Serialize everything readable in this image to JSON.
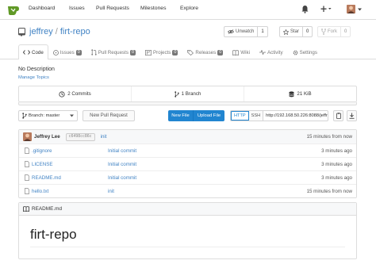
{
  "colors": {
    "brand": "#609926",
    "link": "#4183c4",
    "primary": "#2185d0"
  },
  "topnav": {
    "items": [
      "Dashboard",
      "Issues",
      "Pull Requests",
      "Milestones",
      "Explore"
    ],
    "icons": [
      "bell-icon",
      "plus-icon",
      "avatar"
    ]
  },
  "repo": {
    "owner": "jeffrey",
    "separator": "/",
    "name": "firt-repo",
    "watch": {
      "label": "Unwatch",
      "count": "1"
    },
    "star": {
      "label": "Star",
      "count": "0"
    },
    "fork": {
      "label": "Fork",
      "count": "0"
    }
  },
  "tabs": [
    {
      "label": "Code",
      "icon": "code-icon"
    },
    {
      "label": "Issues",
      "badge": "0",
      "icon": "issue-icon"
    },
    {
      "label": "Pull Requests",
      "badge": "0",
      "icon": "pr-icon"
    },
    {
      "label": "Projects",
      "badge": "0",
      "icon": "projects-icon"
    },
    {
      "label": "Releases",
      "badge": "0",
      "icon": "tag-icon"
    },
    {
      "label": "Wiki",
      "icon": "wiki-icon"
    },
    {
      "label": "Activity",
      "icon": "pulse-icon"
    },
    {
      "label": "Settings",
      "icon": "gear-icon"
    }
  ],
  "description": "No Description",
  "manage_topics": "Manage Topics",
  "stats": {
    "commits": "2 Commits",
    "branches": "1 Branch",
    "size": "21 KiB"
  },
  "toolbar": {
    "branch": "Branch: master",
    "new_pr": "New Pull Request",
    "new_file": "New File",
    "upload_file": "Upload File",
    "http": "HTTP",
    "ssh": "SSH",
    "clone_url": "http://192.168.50.226:8088/jeffr"
  },
  "latest_commit": {
    "author": "Jeffrey Lee",
    "sha": "c6498cc86c",
    "message": "init",
    "age": "15 minutes from now"
  },
  "files": [
    {
      "name": ".gitignore",
      "message": "Initial commit",
      "age": "3 minutes ago"
    },
    {
      "name": "LICENSE",
      "message": "Initial commit",
      "age": "3 minutes ago"
    },
    {
      "name": "README.md",
      "message": "Initial commit",
      "age": "3 minutes ago"
    },
    {
      "name": "hello.txt",
      "message": "init",
      "age": "15 minutes from now"
    }
  ],
  "readme": {
    "filename": "README.md",
    "heading": "firt-repo"
  }
}
